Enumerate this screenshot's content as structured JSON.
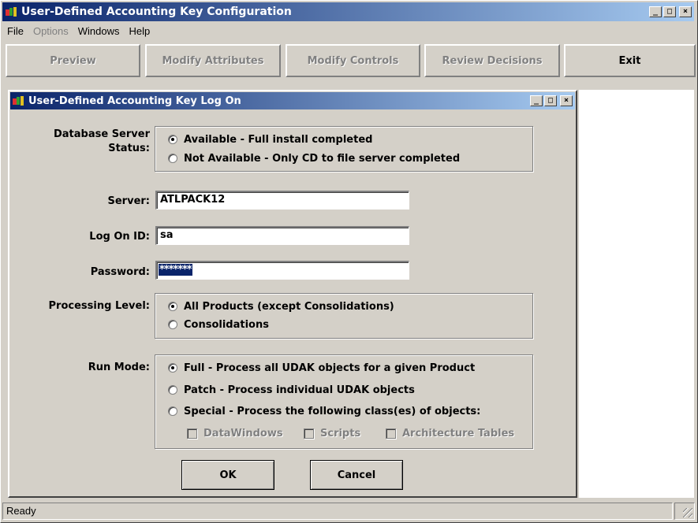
{
  "window": {
    "title": "User-Defined Accounting Key Configuration"
  },
  "menu": [
    {
      "label": "File",
      "enabled": true
    },
    {
      "label": "Options",
      "enabled": false
    },
    {
      "label": "Windows",
      "enabled": true
    },
    {
      "label": "Help",
      "enabled": true
    }
  ],
  "toolbar": {
    "preview": "Preview",
    "modify_attributes": "Modify Attributes",
    "modify_controls": "Modify Controls",
    "review_decisions": "Review Decisions",
    "exit": "Exit"
  },
  "dialog": {
    "title": "User-Defined Accounting Key Log On",
    "db_status": {
      "label_line1": "Database Server",
      "label_line2": "Status:",
      "options": [
        "Available - Full install completed",
        "Not Available - Only CD to file server completed"
      ],
      "selected": "Available - Full install completed"
    },
    "server": {
      "label": "Server:",
      "value": "ATLPACK12"
    },
    "logon": {
      "label": "Log On ID:",
      "value": "sa"
    },
    "password": {
      "label": "Password:",
      "value": "*******"
    },
    "processing": {
      "label": "Processing Level:",
      "options": [
        "All Products (except Consolidations)",
        "Consolidations"
      ],
      "selected": "All Products (except Consolidations)"
    },
    "run_mode": {
      "label": "Run Mode:",
      "options": [
        "Full - Process all UDAK objects for a given Product",
        "Patch - Process individual UDAK objects",
        "Special - Process the following class(es) of objects:"
      ],
      "selected": "Full - Process all UDAK objects for a given Product",
      "classes": [
        "DataWindows",
        "Scripts",
        "Architecture Tables"
      ]
    },
    "ok": "OK",
    "cancel": "Cancel"
  },
  "status": {
    "text": "Ready"
  }
}
